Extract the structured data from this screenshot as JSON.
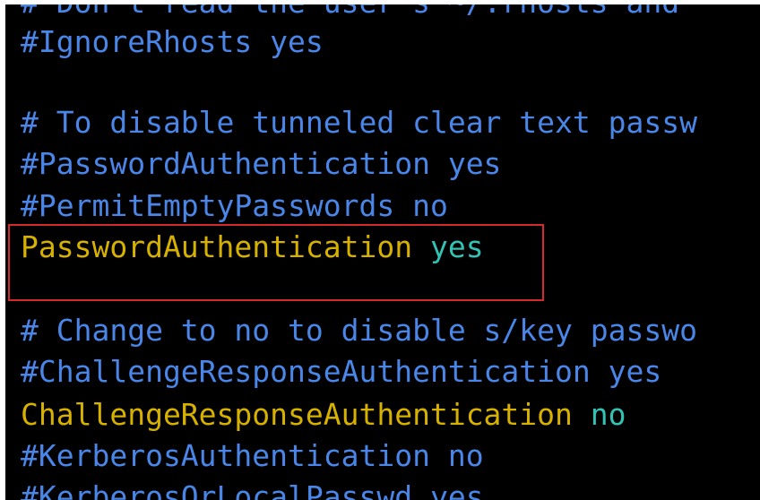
{
  "terminal": {
    "lines": [
      {
        "text": "# Don't read the user's ~/.rhosts and"
      },
      {
        "text": "#IgnoreRhosts yes"
      },
      {
        "text": ""
      },
      {
        "text": "# To disable tunneled clear text passw"
      },
      {
        "text": "#PasswordAuthentication yes"
      },
      {
        "text": "#PermitEmptyPasswords no"
      },
      {
        "key": "PasswordAuthentication",
        "value": "yes"
      },
      {
        "text": ""
      },
      {
        "text": "# Change to no to disable s/key passwo"
      },
      {
        "text": "#ChallengeResponseAuthentication yes"
      },
      {
        "key": "ChallengeResponseAuthentication",
        "value": "no"
      },
      {
        "text": "#KerberosAuthentication no"
      },
      {
        "text": "#KerberosOrLocalPasswd yes"
      }
    ]
  },
  "colors": {
    "background": "#000000",
    "comment": "#4a86e8",
    "key": "#d6b100",
    "value": "#33c3b4",
    "highlight_border": "#d42a2a"
  }
}
